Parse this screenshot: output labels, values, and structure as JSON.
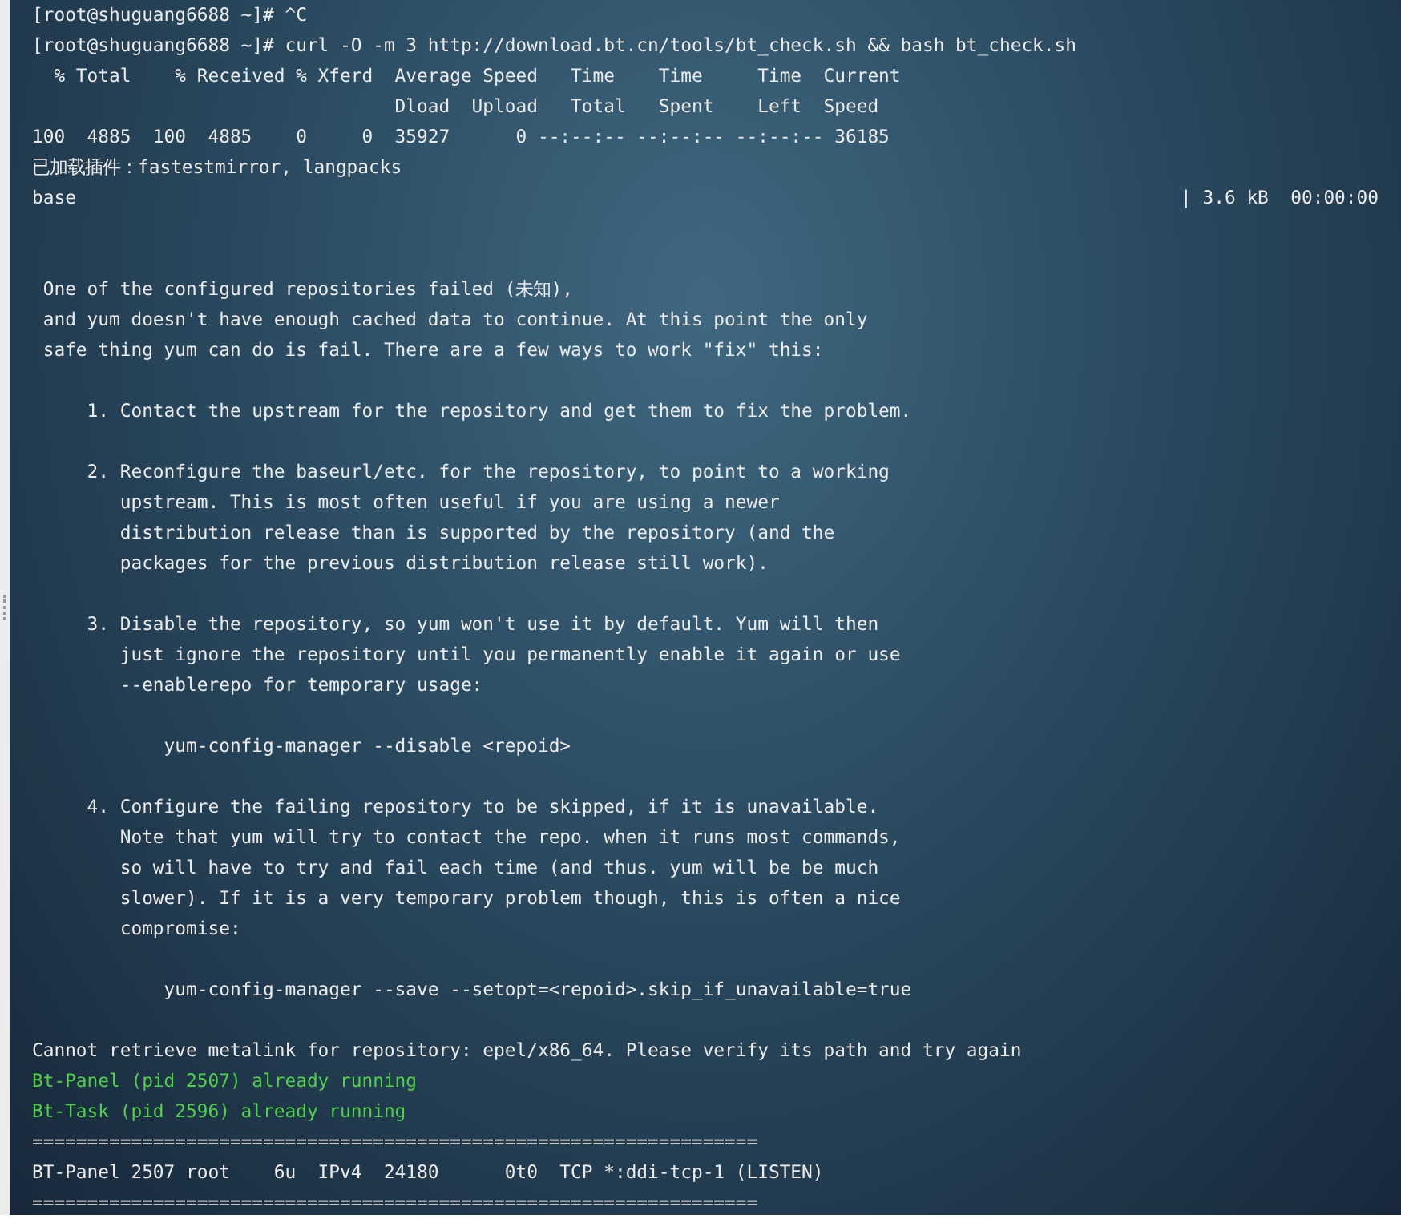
{
  "terminal": {
    "lines": [
      {
        "kind": "output",
        "text": "[root@shuguang6688 ~]# ^C"
      },
      {
        "kind": "output",
        "text": "[root@shuguang6688 ~]# curl -O -m 3 http://download.bt.cn/tools/bt_check.sh && bash bt_check.sh"
      },
      {
        "kind": "output",
        "text": "  % Total    % Received % Xferd  Average Speed   Time    Time     Time  Current"
      },
      {
        "kind": "output",
        "text": "                                 Dload  Upload   Total   Spent    Left  Speed"
      },
      {
        "kind": "output",
        "text": "100  4885  100  4885    0     0  35927      0 --:--:-- --:--:-- --:--:-- 36185"
      },
      {
        "kind": "output",
        "text": "已加载插件：fastestmirror, langpacks"
      },
      {
        "kind": "split",
        "text": "base",
        "right": "| 3.6 kB  00:00:00"
      },
      {
        "kind": "blank"
      },
      {
        "kind": "blank"
      },
      {
        "kind": "output",
        "text": " One of the configured repositories failed (未知),"
      },
      {
        "kind": "output",
        "text": " and yum doesn't have enough cached data to continue. At this point the only"
      },
      {
        "kind": "output",
        "text": " safe thing yum can do is fail. There are a few ways to work \"fix\" this:"
      },
      {
        "kind": "blank"
      },
      {
        "kind": "output",
        "text": "     1. Contact the upstream for the repository and get them to fix the problem."
      },
      {
        "kind": "blank"
      },
      {
        "kind": "output",
        "text": "     2. Reconfigure the baseurl/etc. for the repository, to point to a working"
      },
      {
        "kind": "output",
        "text": "        upstream. This is most often useful if you are using a newer"
      },
      {
        "kind": "output",
        "text": "        distribution release than is supported by the repository (and the"
      },
      {
        "kind": "output",
        "text": "        packages for the previous distribution release still work)."
      },
      {
        "kind": "blank"
      },
      {
        "kind": "output",
        "text": "     3. Disable the repository, so yum won't use it by default. Yum will then"
      },
      {
        "kind": "output",
        "text": "        just ignore the repository until you permanently enable it again or use"
      },
      {
        "kind": "output",
        "text": "        --enablerepo for temporary usage:"
      },
      {
        "kind": "blank"
      },
      {
        "kind": "output",
        "text": "            yum-config-manager --disable <repoid>"
      },
      {
        "kind": "blank"
      },
      {
        "kind": "output",
        "text": "     4. Configure the failing repository to be skipped, if it is unavailable."
      },
      {
        "kind": "output",
        "text": "        Note that yum will try to contact the repo. when it runs most commands,"
      },
      {
        "kind": "output",
        "text": "        so will have to try and fail each time (and thus. yum will be be much"
      },
      {
        "kind": "output",
        "text": "        slower). If it is a very temporary problem though, this is often a nice"
      },
      {
        "kind": "output",
        "text": "        compromise:"
      },
      {
        "kind": "blank"
      },
      {
        "kind": "output",
        "text": "            yum-config-manager --save --setopt=<repoid>.skip_if_unavailable=true"
      },
      {
        "kind": "blank"
      },
      {
        "kind": "output",
        "text": "Cannot retrieve metalink for repository: epel/x86_64. Please verify its path and try again"
      },
      {
        "kind": "success",
        "text": "Bt-Panel (pid 2507) already running"
      },
      {
        "kind": "success",
        "text": "Bt-Task (pid 2596) already running"
      },
      {
        "kind": "output",
        "text": "=================================================================="
      },
      {
        "kind": "output",
        "text": "BT-Panel 2507 root    6u  IPv4  24180      0t0  TCP *:ddi-tcp-1 (LISTEN)"
      },
      {
        "kind": "output",
        "text": "=================================================================="
      }
    ]
  }
}
